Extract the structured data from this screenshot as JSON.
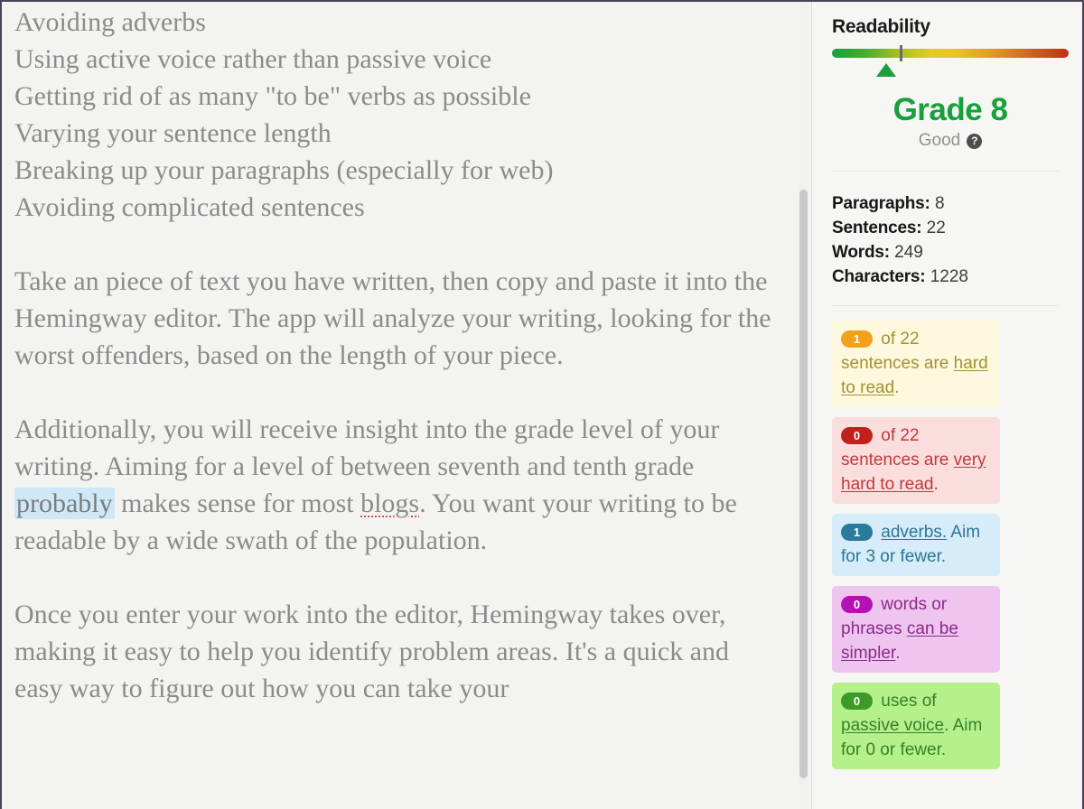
{
  "editor": {
    "paragraphs": [
      {
        "id": "list-adverbs",
        "text": "Avoiding adverbs",
        "spacer": false
      },
      {
        "id": "list-active-voice",
        "text": "Using active voice rather than passive voice",
        "spacer": false
      },
      {
        "id": "list-to-be-verbs",
        "text": "Getting rid of as many \"to be\" verbs as possible",
        "spacer": false
      },
      {
        "id": "list-sentence-length",
        "text": "Varying your sentence length",
        "spacer": false
      },
      {
        "id": "list-break-paragraphs",
        "text": "Breaking up your paragraphs (especially for web)",
        "spacer": false
      },
      {
        "id": "list-complicated-sentences",
        "text": "Avoiding complicated sentences",
        "spacer": true
      },
      {
        "id": "para-take-a-piece",
        "text": "Take an piece of text you have written, then copy and paste it into the Hemingway editor. The app will analyze your writing, looking for the worst offenders, based on the length of your piece.",
        "spacer": true
      },
      {
        "id": "para-grade-level",
        "text": "Additionally, you will receive insight into the grade level of your writing. Aiming for a level of between seventh and tenth grade probably makes sense for most blogs. You want your writing to be readable by a wide swath of the population.",
        "spacer": true
      },
      {
        "id": "para-once-you-enter",
        "text": "Once you enter your work into the editor, Hemingway takes over, making it easy to help you identify problem areas.  It's a quick and easy way to figure out how you can take your",
        "spacer": false
      }
    ],
    "grade_paragraph_parts": {
      "before": "Additionally, you will receive insight into the grade level of your writing. Aiming for a level of between seventh and tenth grade ",
      "adverb": "probably",
      "middle": " makes sense for most ",
      "misspelled": "blogs",
      "after": ". You want your writing to be readable by a wide swath of the population."
    }
  },
  "sidebar": {
    "title": "Readability",
    "gauge": {
      "pointer_position_percent": 19,
      "tick_position_percent": 29,
      "pointer_color": "#1f9e3e",
      "gradient_start": "#1a9e3c",
      "gradient_end": "#bb3018"
    },
    "grade": {
      "value": "Grade 8",
      "label": "Good",
      "help_icon_glyph": "?",
      "color": "#17a03c"
    },
    "stats": [
      {
        "label": "Paragraphs:",
        "value": "8"
      },
      {
        "label": "Sentences:",
        "value": "22"
      },
      {
        "label": "Words:",
        "value": "249"
      },
      {
        "label": "Characters:",
        "value": "1228"
      }
    ],
    "cards": [
      {
        "name": "hard-to-read",
        "count": "1",
        "lead": " of 22",
        "body": " sentences are ",
        "emphasis": "hard to read",
        "tail": ".",
        "extra": "",
        "bg": "#fdf8de",
        "pill": "#f3a01c"
      },
      {
        "name": "very-hard-to-read",
        "count": "0",
        "lead": " of 22",
        "body": " sentences are ",
        "emphasis": "very hard to read",
        "tail": ".",
        "extra": "",
        "bg": "#fadddd",
        "pill": "#c2201d"
      },
      {
        "name": "adverbs",
        "count": "1",
        "lead": "",
        "body": " ",
        "emphasis": "adverbs.",
        "tail": " Aim for 3 or fewer.",
        "extra": "",
        "bg": "#d6ecf8",
        "pill": "#2a7a9b"
      },
      {
        "name": "simpler-words",
        "count": "0",
        "lead": "",
        "body": " words or phrases ",
        "emphasis": "can be simpler",
        "tail": ".",
        "extra": "",
        "bg": "#eec5ee",
        "pill": "#b412b4"
      },
      {
        "name": "passive-voice",
        "count": "0",
        "lead": "",
        "body": " uses of ",
        "emphasis": "passive voice",
        "tail": ". Aim for 0 or fewer.",
        "extra": "",
        "bg": "#b6f08b",
        "pill": "#3c9a26"
      }
    ]
  }
}
